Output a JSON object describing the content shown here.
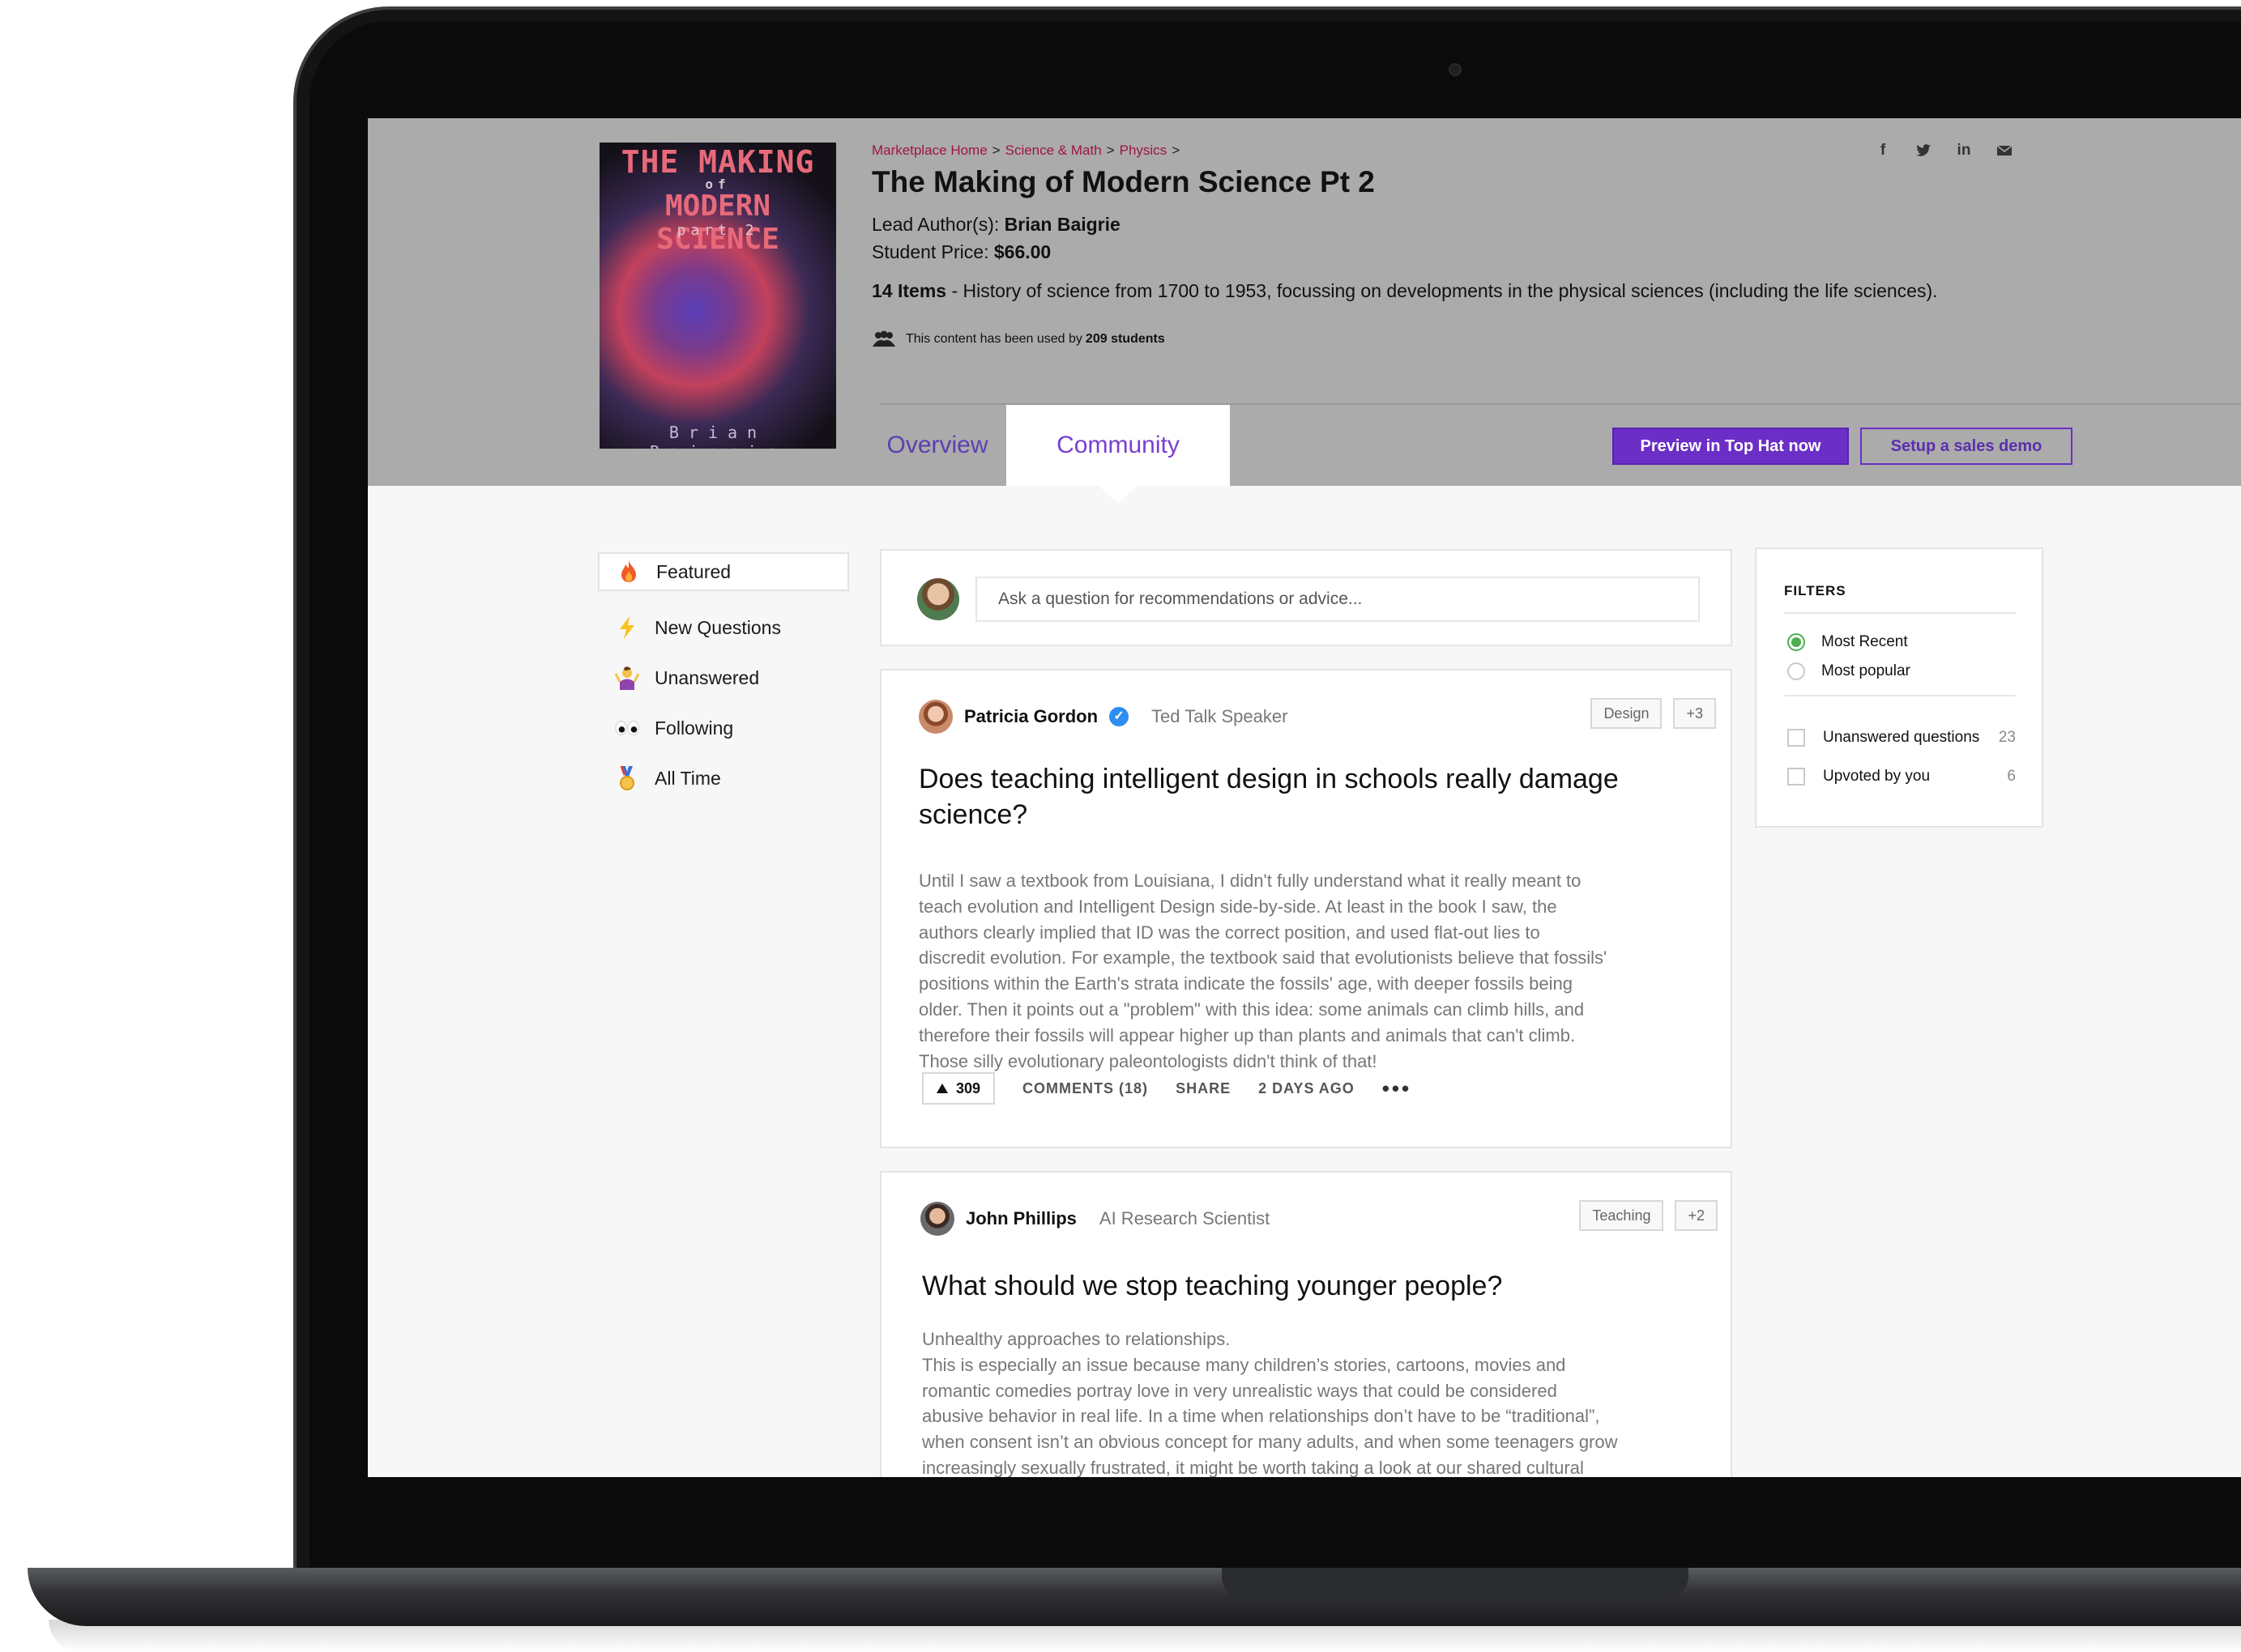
{
  "header": {
    "cover": {
      "line1": "THE MAKING",
      "line2": "of",
      "line3": "MODERN SCIENCE",
      "line4": "part 2",
      "author": "Brian Baigrie"
    },
    "breadcrumb": [
      "Marketplace Home",
      "Science & Math",
      "Physics"
    ],
    "breadcrumb_separator": ">",
    "title": "The Making of Modern Science Pt 2",
    "lead_author_label": "Lead Author(s):",
    "lead_author": "Brian Baigrie",
    "price_label": "Student Price:",
    "price": "$66.00",
    "items_count": "14 Items",
    "description": " - History of science from 1700 to 1953, focussing on developments in the physical sciences (including the life sciences).",
    "usage_prefix": "This content has been used by",
    "usage_count": "209 students",
    "social_icons": [
      "facebook-icon",
      "twitter-icon",
      "linkedin-icon",
      "email-icon"
    ],
    "tabs": [
      {
        "label": "Overview",
        "active": false
      },
      {
        "label": "Community",
        "active": true
      }
    ],
    "primary_button": "Preview in Top Hat now",
    "secondary_button": "Setup a sales demo",
    "colors": {
      "accent": "#6b2fc7",
      "breadcrumb": "#a0153e",
      "header_bg": "#ababab"
    }
  },
  "nav": {
    "items": [
      {
        "label": "Featured",
        "icon": "fire-icon",
        "active": true
      },
      {
        "label": "New Questions",
        "icon": "lightning-icon",
        "active": false
      },
      {
        "label": "Unanswered",
        "icon": "person-shrugging-icon",
        "active": false
      },
      {
        "label": "Following",
        "icon": "eyes-icon",
        "active": false
      },
      {
        "label": "All Time",
        "icon": "medal-icon",
        "active": false
      }
    ]
  },
  "ask": {
    "placeholder": "Ask a question for recommendations or advice..."
  },
  "posts": [
    {
      "author": "Patricia Gordon",
      "verified": true,
      "role": "Ted Talk Speaker",
      "tags": [
        "Design",
        "+3"
      ],
      "title": "Does teaching intelligent design in schools really damage science?",
      "body": "Until I saw a textbook from Louisiana, I didn't fully understand what it really meant to\nteach evolution and Intelligent Design side-by-side. At least in the book I saw, the\nauthors clearly implied that ID was the correct position, and used flat-out lies to\ndiscredit evolution. For example, the textbook said that evolutionists believe that fossils'\npositions within the Earth's strata indicate the fossils' age, with deeper fossils being\nolder. Then it points out a \"problem\" with this idea: some animals can climb hills, and\ntherefore their fossils will appear higher up than plants and animals that can't climb.\nThose silly evolutionary paleontologists didn't think of that!",
      "upvotes": "309",
      "comments": "COMMENTS (18)",
      "share": "SHARE",
      "time": "2 DAYS AGO",
      "more": "•••"
    },
    {
      "author": "John Phillips",
      "verified": false,
      "role": "AI Research Scientist",
      "tags": [
        "Teaching",
        "+2"
      ],
      "title": "What should we stop teaching younger people?",
      "body": "Unhealthy approaches to relationships.\nThis is especially an issue because many children’s stories, cartoons, movies and\nromantic comedies portray love in very unrealistic ways that could be considered\nabusive behavior in real life. In a time when relationships don’t have to be “traditional”,\nwhen consent isn’t an obvious concept for many adults, and when some teenagers grow\nincreasingly sexually frustrated, it might be worth taking a look at our shared cultural"
    }
  ],
  "filters": {
    "title": "FILTERS",
    "sort_options": [
      {
        "label": "Most Recent",
        "selected": true
      },
      {
        "label": "Most popular",
        "selected": false
      }
    ],
    "checkboxes": [
      {
        "label": "Unanswered questions",
        "count": "23",
        "checked": false
      },
      {
        "label": "Upvoted by you",
        "count": "6",
        "checked": false
      }
    ]
  }
}
